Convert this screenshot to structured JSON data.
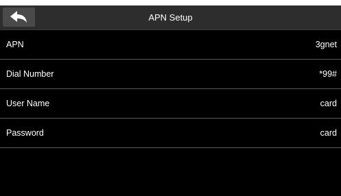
{
  "header": {
    "title": "APN Setup",
    "back_icon": "back-arrow-icon"
  },
  "settings": {
    "items": [
      {
        "label": "APN",
        "value": "3gnet"
      },
      {
        "label": "Dial Number",
        "value": "*99#"
      },
      {
        "label": "User Name",
        "value": "card"
      },
      {
        "label": "Password",
        "value": "card"
      }
    ]
  },
  "colors": {
    "background": "#000000",
    "header": "#2d2d2d",
    "back_button": "#4a4a4a",
    "divider": "#5a5a5a",
    "text": "#ffffff"
  }
}
